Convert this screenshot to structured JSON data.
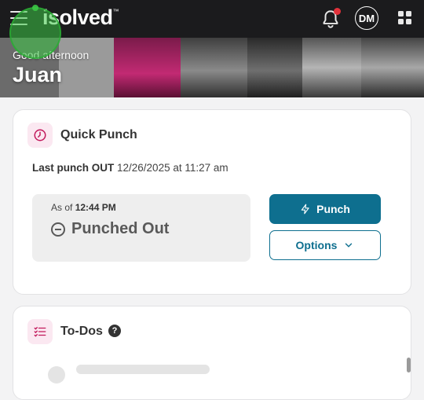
{
  "header": {
    "logo_text": "isolved",
    "logo_mark": "™",
    "avatar_initials": "DM",
    "icons": [
      "menu-icon",
      "bell-icon",
      "apps-grid-icon"
    ],
    "notification_dot_color": "#e2323b"
  },
  "banner": {
    "greeting": "Good afternoon",
    "name": "Juan"
  },
  "quick_punch": {
    "title": "Quick Punch",
    "last_punch_label": "Last punch OUT",
    "last_punch_value": "12/26/2025 at 11:27 am",
    "as_of_label": "As of",
    "as_of_time": "12:44 PM",
    "status": "Punched Out",
    "punch_button": "Punch",
    "options_button": "Options",
    "accent_color": "#0e6f8f",
    "icon_tint": "#fbe8f1"
  },
  "todos": {
    "title": "To-Dos",
    "help_glyph": "?"
  }
}
